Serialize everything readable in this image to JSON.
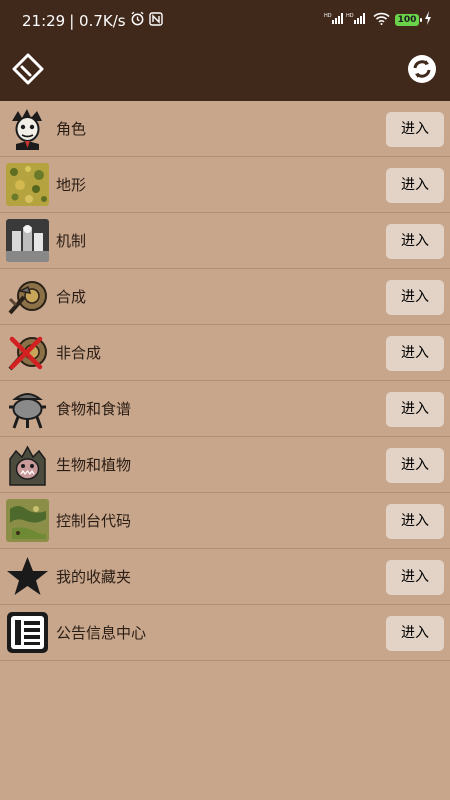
{
  "status": {
    "time": "21:29",
    "speed": "| 0.7K/s",
    "battery": "100",
    "icons": [
      "alarm-icon",
      "nfc-icon",
      "hd-signal-icon",
      "wifi-icon",
      "battery-icon",
      "charging-icon"
    ]
  },
  "appbar": {
    "left_icon": "tag-icon",
    "right_icon": "refresh-icon"
  },
  "list": {
    "button_label": "进入",
    "items": [
      {
        "label": "角色",
        "icon": "character-icon"
      },
      {
        "label": "地形",
        "icon": "terrain-icon"
      },
      {
        "label": "机制",
        "icon": "mechanism-icon"
      },
      {
        "label": "合成",
        "icon": "crafting-icon"
      },
      {
        "label": "非合成",
        "icon": "non-crafting-icon"
      },
      {
        "label": "食物和食谱",
        "icon": "crockpot-icon"
      },
      {
        "label": "生物和植物",
        "icon": "creature-icon"
      },
      {
        "label": "控制台代码",
        "icon": "console-map-icon"
      },
      {
        "label": "我的收藏夹",
        "icon": "star-icon"
      },
      {
        "label": "公告信息中心",
        "icon": "list-icon"
      }
    ]
  },
  "colors": {
    "header": "#40281a",
    "background": "#c8a68c",
    "button": "#e3d3c6",
    "divider": "#ad8f79"
  }
}
